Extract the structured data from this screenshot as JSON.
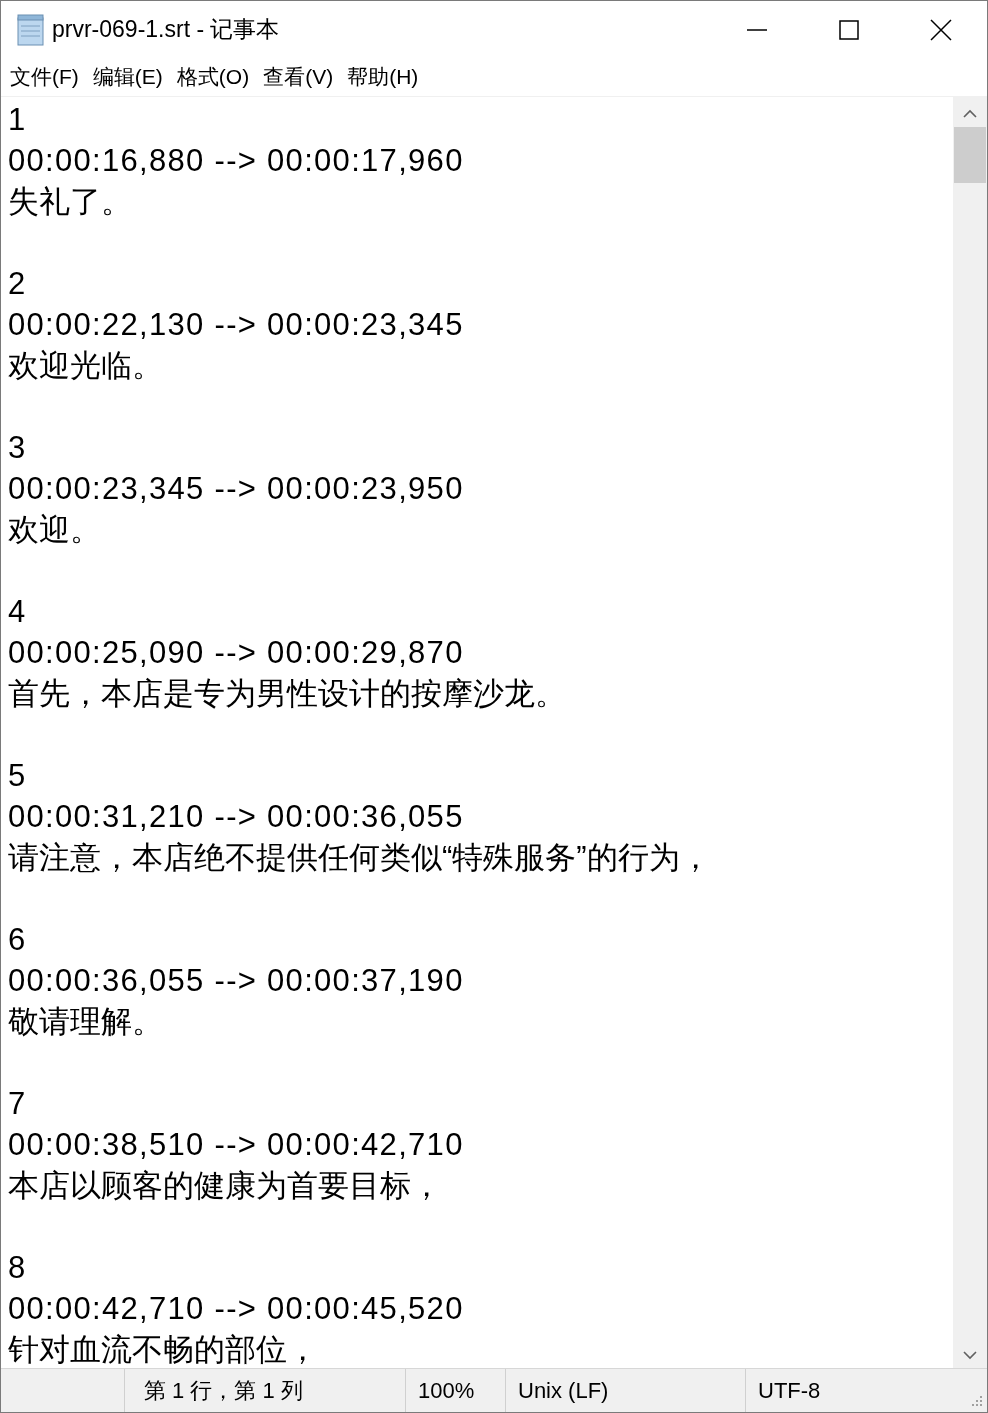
{
  "window": {
    "title": "prvr-069-1.srt - 记事本"
  },
  "menu": [
    "文件(F)",
    "编辑(E)",
    "格式(O)",
    "查看(V)",
    "帮助(H)"
  ],
  "entries": [
    {
      "index": "1",
      "timing": "00:00:16,880 --> 00:00:17,960",
      "text": "失礼了。"
    },
    {
      "index": "2",
      "timing": "00:00:22,130 --> 00:00:23,345",
      "text": "欢迎光临。"
    },
    {
      "index": "3",
      "timing": "00:00:23,345 --> 00:00:23,950",
      "text": "欢迎。"
    },
    {
      "index": "4",
      "timing": "00:00:25,090 --> 00:00:29,870",
      "text": "首先，本店是专为男性设计的按摩沙龙。"
    },
    {
      "index": "5",
      "timing": "00:00:31,210 --> 00:00:36,055",
      "text": "请注意，本店绝不提供任何类似“特殊服务”的行为，"
    },
    {
      "index": "6",
      "timing": "00:00:36,055 --> 00:00:37,190",
      "text": "敬请理解。"
    },
    {
      "index": "7",
      "timing": "00:00:38,510 --> 00:00:42,710",
      "text": "本店以顾客的健康为首要目标，"
    },
    {
      "index": "8",
      "timing": "00:00:42,710 --> 00:00:45,520",
      "text": "针对血流不畅的部位，"
    }
  ],
  "status_bar": {
    "position": "第 1 行，第 1 列",
    "zoom": "100%",
    "line_ending": "Unix (LF)",
    "encoding": "UTF-8"
  }
}
